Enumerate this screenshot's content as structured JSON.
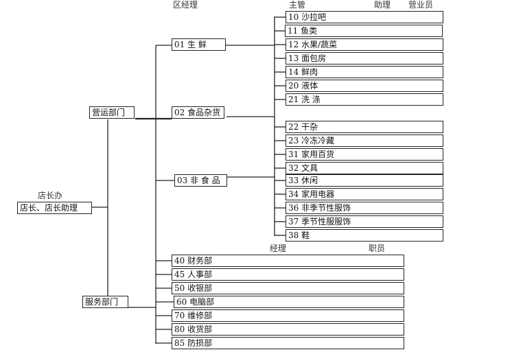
{
  "headers": {
    "district_manager": "区经理",
    "supervisor": "主管",
    "assistant": "助理",
    "salesperson": "营业员",
    "manager": "经理",
    "staff": "职员",
    "store_office": "店长办"
  },
  "store_office_box": "店长、店长助理",
  "operations_dept": "营运部门",
  "service_dept": "服务部门",
  "divisions": [
    "01 生  鲜",
    "02 食品杂货",
    "03 非 食 品"
  ],
  "sections": [
    "10 沙拉吧",
    "11 鱼类",
    "12 水果/蔬菜",
    "13 面包房",
    "14 鲜肉",
    "20 液体",
    "21 洗   涤",
    "22 干杂",
    "23 冷冻冷藏",
    "31 家用百货",
    "32 文具",
    "33 休闲",
    "34 家用电器",
    "36 非季节性服饰",
    "37 季节性服服饰",
    "38 鞋"
  ],
  "service_units": [
    "40 财务部",
    "45 人事部",
    "50 收银部",
    "60 电脑部",
    "70 维修部",
    "80 收货部",
    "85 防损部"
  ]
}
